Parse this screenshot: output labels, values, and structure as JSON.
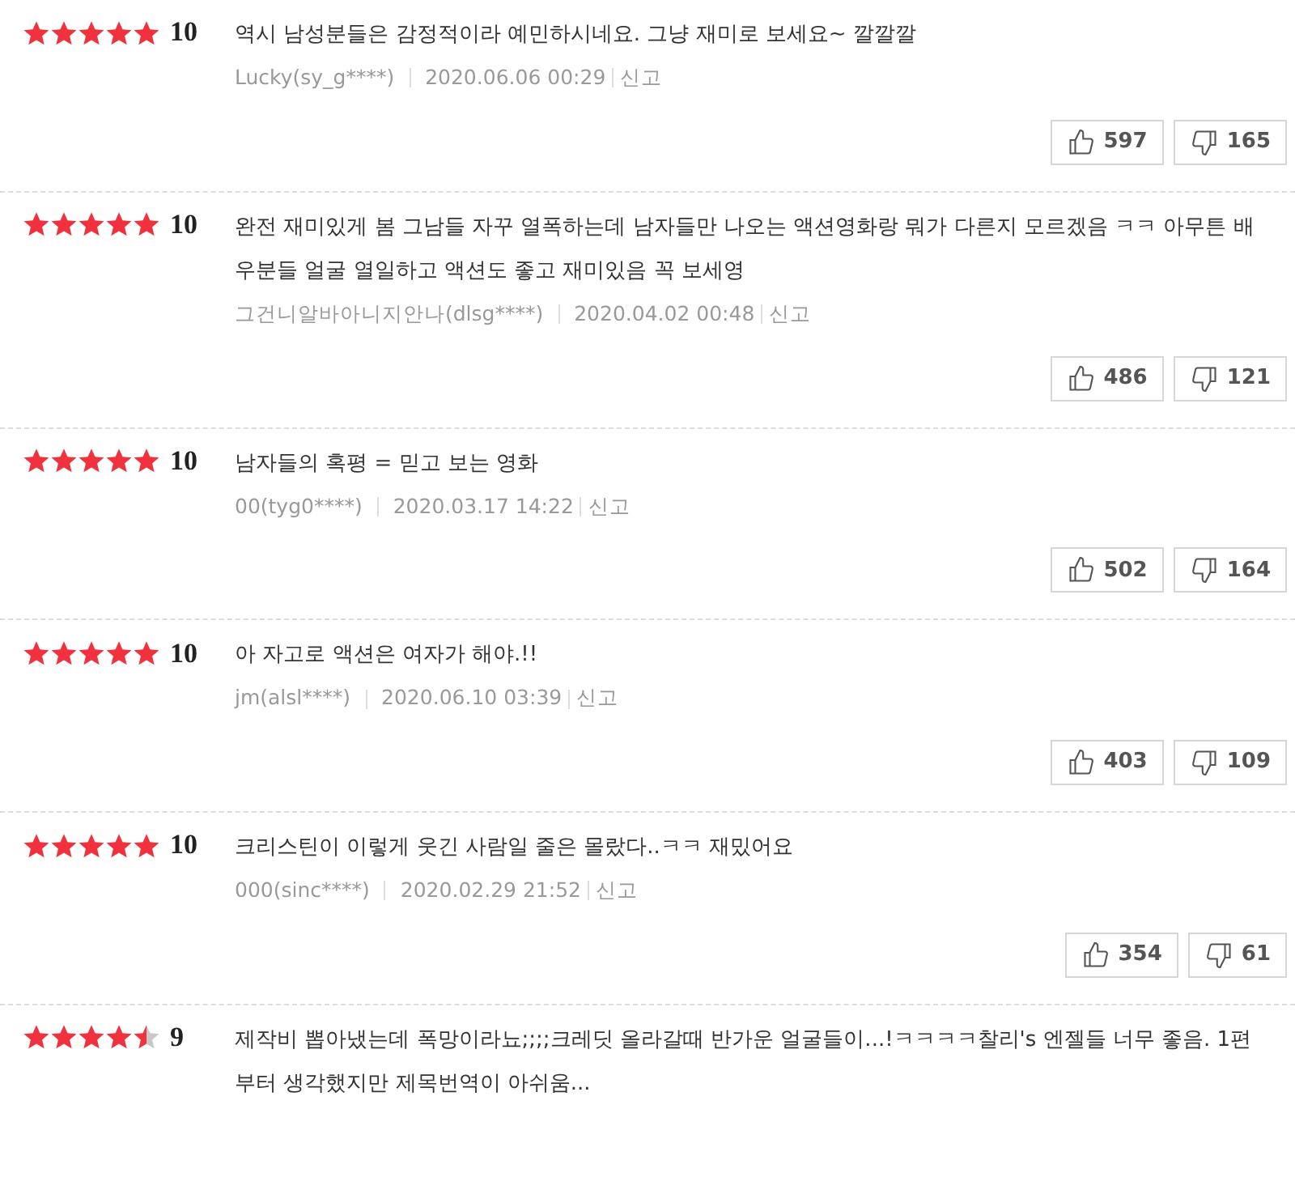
{
  "reviews": [
    {
      "stars": 5,
      "score": "10",
      "text": "역시 남성분들은 감정적이라 예민하시네요. 그냥 재미로 보세요~ 깔깔깔",
      "author": "Lucky(sy_g****)",
      "date": "2020.06.06 00:29",
      "report": "신고",
      "likes": "597",
      "dislikes": "165"
    },
    {
      "stars": 5,
      "score": "10",
      "text": "완전 재미있게 봄 그남들 자꾸 열폭하는데 남자들만 나오는 액션영화랑 뭐가 다른지 모르겠음 ㅋㅋ 아무튼 배우분들 얼굴 열일하고 액션도 좋고 재미있음 꼭 보세영",
      "author": "그건니알바아니지안나(dlsg****)",
      "date": "2020.04.02 00:48",
      "report": "신고",
      "likes": "486",
      "dislikes": "121"
    },
    {
      "stars": 5,
      "score": "10",
      "text": "남자들의 혹평 = 믿고 보는 영화",
      "author": "00(tyg0****)",
      "date": "2020.03.17 14:22",
      "report": "신고",
      "likes": "502",
      "dislikes": "164"
    },
    {
      "stars": 5,
      "score": "10",
      "text": "아 자고로 액션은 여자가 해야.!!",
      "author": "jm(alsl****)",
      "date": "2020.06.10 03:39",
      "report": "신고",
      "likes": "403",
      "dislikes": "109"
    },
    {
      "stars": 5,
      "score": "10",
      "text": "크리스틴이 이렇게 웃긴 사람일 줄은 몰랐다..ㅋㅋ 재밌어요",
      "author": "000(sinc****)",
      "date": "2020.02.29 21:52",
      "report": "신고",
      "likes": "354",
      "dislikes": "61"
    },
    {
      "stars": 4.5,
      "score": "9",
      "text": "제작비 뽑아냈는데 폭망이라뇨;;;;크레딧 올라갈때 반가운 얼굴들이...!ㅋㅋㅋㅋ찰리's 엔젤들 너무 좋음. 1편부터 생각했지만 제목번역이 아쉬움..."
    }
  ]
}
